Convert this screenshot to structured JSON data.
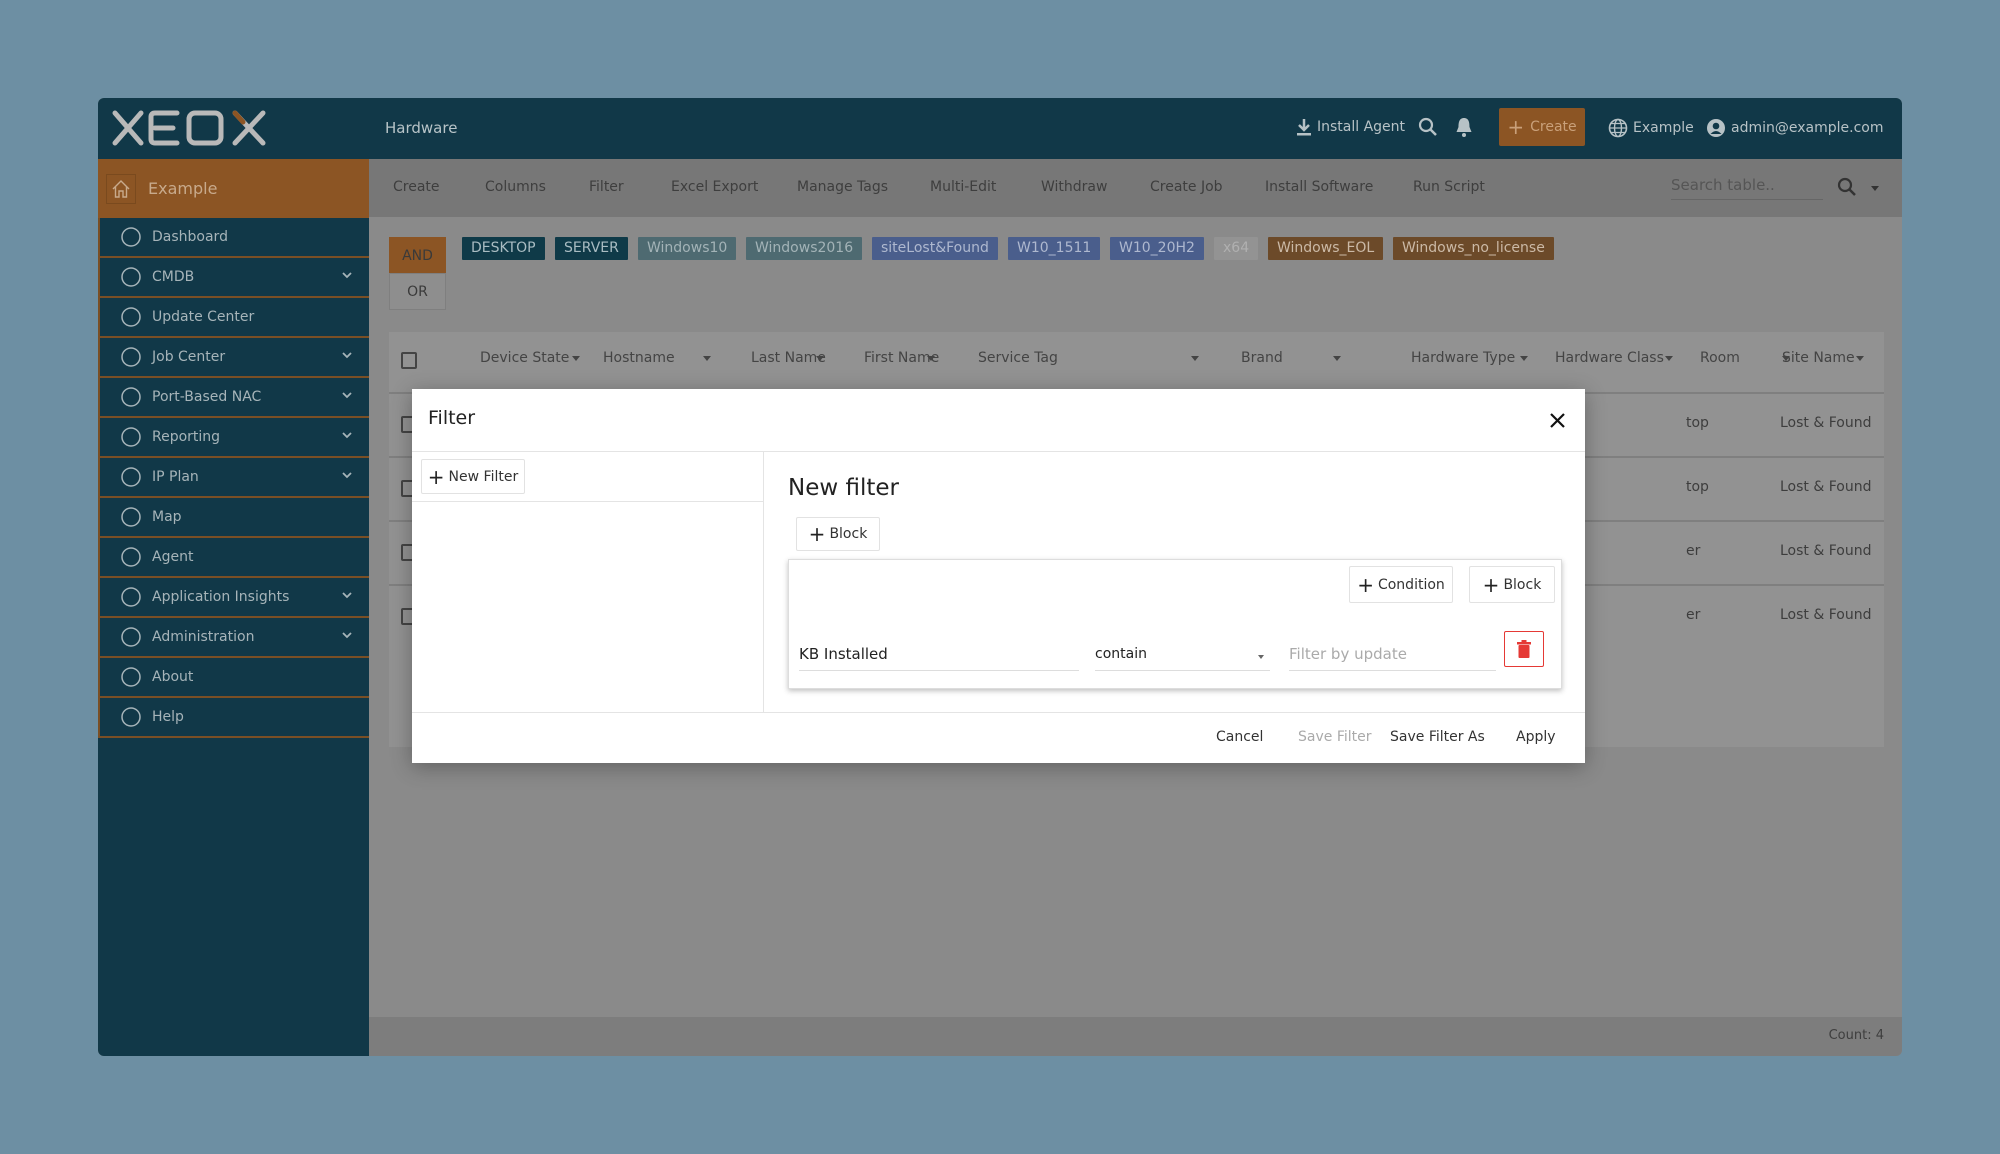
{
  "header": {
    "logo_text": "XEOX",
    "title": "Hardware",
    "install_agent": "Install Agent",
    "create": "Create",
    "tenant": "Example",
    "user": "admin@example.com"
  },
  "sidebar": {
    "home": "Example",
    "items": [
      {
        "label": "Dashboard",
        "icon": "dashboard-gauge-icon",
        "expandable": false
      },
      {
        "label": "CMDB",
        "icon": "monitor-icon",
        "expandable": true
      },
      {
        "label": "Update Center",
        "icon": "clock-refresh-icon",
        "expandable": false
      },
      {
        "label": "Job Center",
        "icon": "robot-icon",
        "expandable": true
      },
      {
        "label": "Port-Based NAC",
        "icon": "network-switch-icon",
        "expandable": true
      },
      {
        "label": "Reporting",
        "icon": "report-chart-icon",
        "expandable": true
      },
      {
        "label": "IP Plan",
        "icon": "ip-plan-icon",
        "expandable": true
      },
      {
        "label": "Map",
        "icon": "map-pin-icon",
        "expandable": false
      },
      {
        "label": "Agent",
        "icon": "agent-x-icon",
        "expandable": false
      },
      {
        "label": "Application Insights",
        "icon": "document-icon",
        "expandable": true
      },
      {
        "label": "Administration",
        "icon": "admin-user-icon",
        "expandable": true
      },
      {
        "label": "About",
        "icon": "info-icon",
        "expandable": false
      },
      {
        "label": "Help",
        "icon": "help-icon",
        "expandable": false
      }
    ]
  },
  "toolbar": {
    "items": [
      "Create",
      "Columns",
      "Filter",
      "Excel Export",
      "Manage Tags",
      "Multi-Edit",
      "Withdraw",
      "Create Job",
      "Install Software",
      "Run Script"
    ],
    "search_placeholder": "Search table.."
  },
  "logic": {
    "and": "AND",
    "or": "OR"
  },
  "tags": [
    {
      "label": "DESKTOP",
      "bg": "#0f3a48",
      "fg": "#a9bcc2"
    },
    {
      "label": "SERVER",
      "bg": "#0f3a48",
      "fg": "#a9bcc2"
    },
    {
      "label": "Windows10",
      "bg": "#4e6a71",
      "fg": "#a3b3b7"
    },
    {
      "label": "Windows2016",
      "bg": "#4e6a71",
      "fg": "#a3b3b7"
    },
    {
      "label": "siteLost&Found",
      "bg": "#4a5e8c",
      "fg": "#aeb8cf"
    },
    {
      "label": "W10_1511",
      "bg": "#4a5e8c",
      "fg": "#aeb8cf"
    },
    {
      "label": "W10_20H2",
      "bg": "#4a5e8c",
      "fg": "#aeb8cf"
    },
    {
      "label": "x64",
      "bg": "#939393",
      "fg": "#b0b0b0"
    },
    {
      "label": "Windows_EOL",
      "bg": "#6c4a29",
      "fg": "#cbb9a6"
    },
    {
      "label": "Windows_no_license",
      "bg": "#6c4a29",
      "fg": "#cbb9a6"
    }
  ],
  "table": {
    "columns": [
      "Device State",
      "Hostname",
      "Last Name",
      "First Name",
      "Service Tag",
      "Brand",
      "Hardware Type",
      "Hardware Class",
      "Room",
      "Site Name"
    ],
    "rows": [
      {
        "hardware_type_partial": "top",
        "site": "Lost & Found"
      },
      {
        "hardware_type_partial": "top",
        "site": "Lost & Found"
      },
      {
        "hardware_type_partial": "er",
        "site": "Lost & Found"
      },
      {
        "hardware_type_partial": "er",
        "site": "Lost & Found"
      }
    ],
    "count": "Count: 4"
  },
  "modal": {
    "title": "Filter",
    "new_filter_btn": "New Filter",
    "heading": "New filter",
    "block_btn": "Block",
    "condition_btn": "Condition",
    "inner_block_btn": "Block",
    "field": "KB Installed",
    "operator": "contain",
    "value_placeholder": "Filter by update",
    "cancel": "Cancel",
    "save": "Save Filter",
    "save_as": "Save Filter As",
    "apply": "Apply"
  },
  "colors": {
    "accent": "#8c5524",
    "primary": "#113848",
    "delete": "#e53935"
  }
}
